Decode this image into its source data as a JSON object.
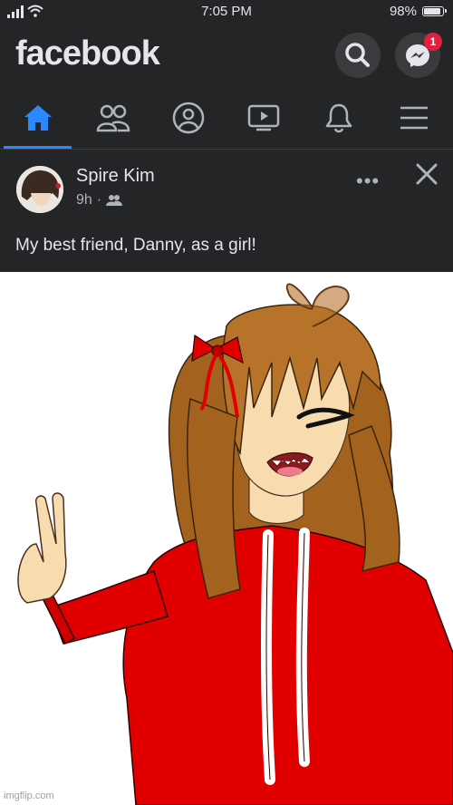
{
  "status_bar": {
    "time": "7:05 PM",
    "battery_percent": "98%"
  },
  "header": {
    "logo": "facebook",
    "messenger_badge": "1"
  },
  "nav": {
    "tabs": [
      "home",
      "friends",
      "profile",
      "watch",
      "notifications",
      "menu"
    ],
    "active_tab": "home"
  },
  "post": {
    "author": "Spire Kim",
    "time": "9h",
    "audience_icon": "friends-icon",
    "more_label": "•••",
    "text": "My best friend, Danny, as a girl!"
  },
  "image": {
    "watermark": "imgflip.com"
  },
  "colors": {
    "background": "#242526",
    "text": "#e4e6eb",
    "accent": "#2d88ff",
    "badge": "#e41e3f",
    "hoodie": "#e00000",
    "hair": "#b8732b"
  }
}
